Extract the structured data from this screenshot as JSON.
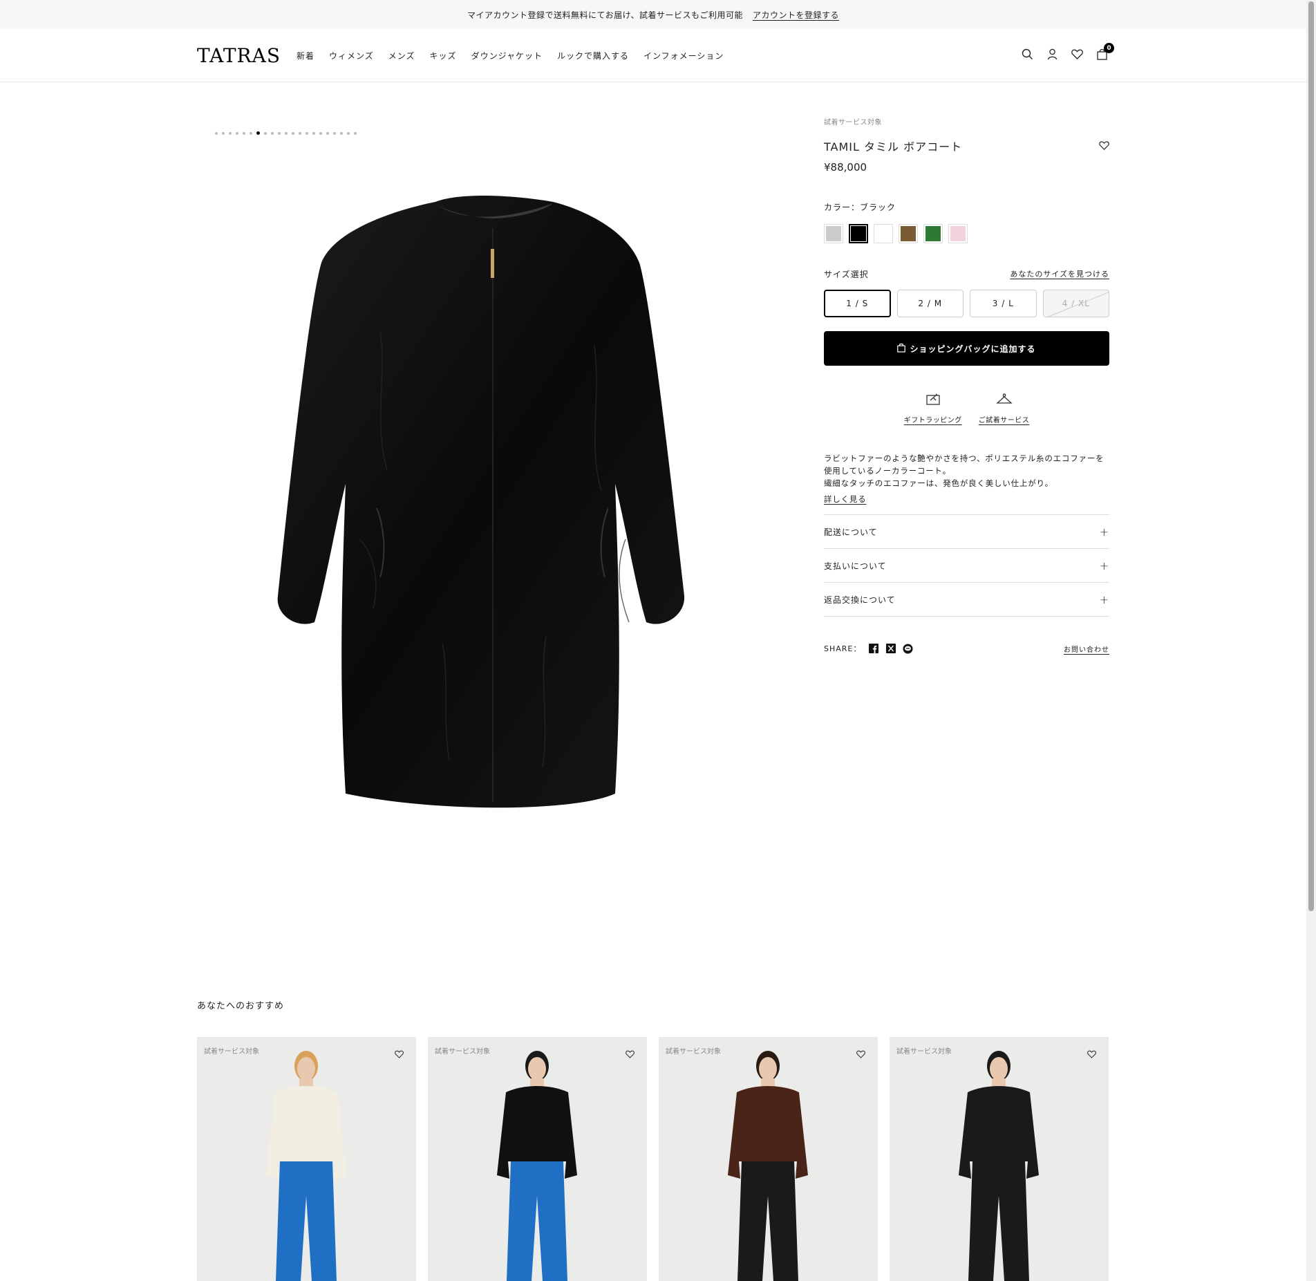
{
  "announcement": {
    "text": "マイアカウント登録で送料無料にてお届け、試着サービスもご利用可能",
    "link": "アカウントを登録する"
  },
  "header": {
    "logo": "TATRAS",
    "nav": [
      "新着",
      "ウィメンズ",
      "メンズ",
      "キッズ",
      "ダウンジャケット",
      "ルックで購入する",
      "インフォメーション"
    ],
    "icons": [
      "search-icon",
      "account-icon",
      "wishlist-icon",
      "bag-icon"
    ],
    "cart_count": "0"
  },
  "gallery": {
    "dot_count": 21,
    "active_dot": 6
  },
  "product": {
    "trial_tag": "試着サービス対象",
    "title": "TAMIL タミル ボアコート",
    "price": "¥88,000",
    "color_label": "カラー：ブラック",
    "swatches": [
      {
        "color": "#cbcbcb",
        "selected": false
      },
      {
        "color": "#000000",
        "selected": true
      },
      {
        "color": "#ffffff",
        "selected": false
      },
      {
        "color": "#7a5c33",
        "selected": false
      },
      {
        "color": "#2e7a35",
        "selected": false
      },
      {
        "color": "#f0d2da",
        "selected": false
      }
    ],
    "size_label": "サイズ選択",
    "size_finder": "あなたのサイズを見つける",
    "sizes": [
      {
        "label": "1 / S",
        "state": "selected"
      },
      {
        "label": "2 / M",
        "state": "available"
      },
      {
        "label": "3 / L",
        "state": "available"
      },
      {
        "label": "4 / XL",
        "state": "soldout"
      }
    ],
    "add_to_bag": "ショッピングバッグに追加する",
    "services": [
      {
        "label": "ギフトラッピング",
        "icon": "gift-icon"
      },
      {
        "label": "ご試着サービス",
        "icon": "hanger-icon"
      }
    ],
    "description": [
      "ラビットファーのような艶やかさを持つ、ポリエステル糸のエコファーを",
      "使用しているノーカラーコート。",
      "繊細なタッチのエコファーは、発色が良く美しい仕上がり。"
    ],
    "more_link": "詳しく見る",
    "accordion": [
      "配送について",
      "支払いについて",
      "返品交換について"
    ],
    "share_label": "SHARE：",
    "share_icons": [
      "facebook-icon",
      "x-icon",
      "line-icon"
    ],
    "contact": "お問い合わせ"
  },
  "recommendations": {
    "title": "あなたへのおすすめ",
    "items": [
      {
        "tag": "試着サービス対象",
        "top_color": "#f3eee2",
        "bottom_color": "#1f6fc4",
        "hair": "#d9a15c"
      },
      {
        "tag": "試着サービス対象",
        "top_color": "#111111",
        "bottom_color": "#1f6fc4",
        "hair": "#1a1a1a"
      },
      {
        "tag": "試着サービス対象",
        "top_color": "#4a2418",
        "bottom_color": "#1a1a1a",
        "hair": "#2a1a12"
      },
      {
        "tag": "試着サービス対象",
        "top_color": "#1a1a1c",
        "bottom_color": "#1a1a1c",
        "hair": "#1a1a1a"
      }
    ]
  }
}
